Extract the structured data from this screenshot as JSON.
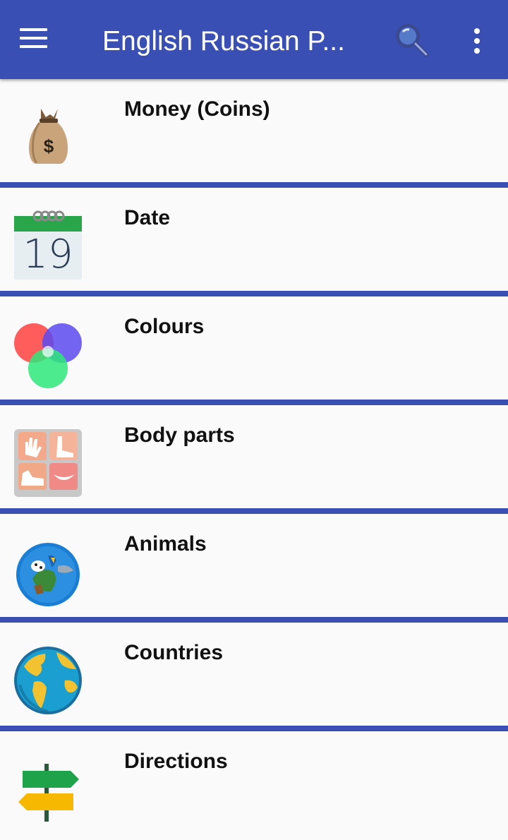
{
  "appbar": {
    "title": "English Russian P...",
    "menu_icon": "hamburger-menu-icon",
    "search_icon": "search-icon",
    "more_icon": "more-vert-icon",
    "color": "#3a4fb4"
  },
  "items": [
    {
      "label": "Money (Coins)",
      "icon": "money-bag-icon"
    },
    {
      "label": "Date",
      "icon": "calendar-icon",
      "calendar_day": "19"
    },
    {
      "label": "Colours",
      "icon": "color-circles-icon"
    },
    {
      "label": "Body parts",
      "icon": "body-parts-icon"
    },
    {
      "label": "Animals",
      "icon": "animals-globe-icon"
    },
    {
      "label": "Countries",
      "icon": "earth-globe-icon"
    },
    {
      "label": "Directions",
      "icon": "signpost-icon"
    }
  ]
}
